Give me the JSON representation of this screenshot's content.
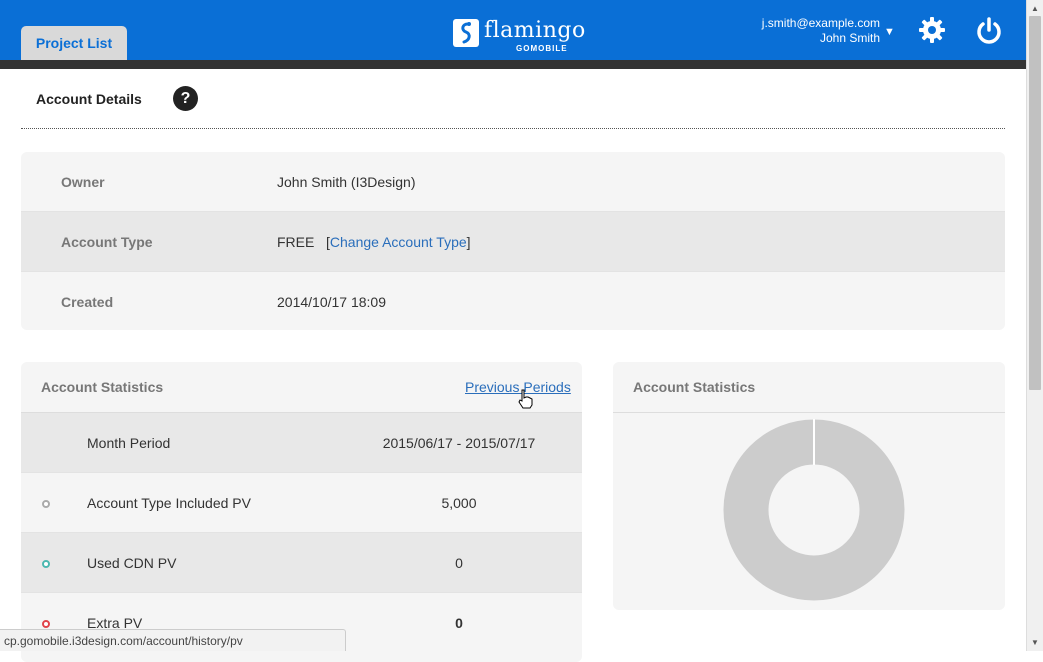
{
  "header": {
    "tab_label": "Project List",
    "logo_text": "flamingo",
    "logo_sub": "GOMOBILE",
    "user_email": "j.smith@example.com",
    "user_name": "John Smith",
    "icons": [
      "caret-down-icon",
      "gear-icon",
      "power-icon"
    ],
    "accent_color": "#0a6fd6"
  },
  "page": {
    "title": "Account Details",
    "help_icon": "?"
  },
  "details": [
    {
      "label": "Owner",
      "value": "John Smith (I3Design)"
    },
    {
      "label": "Account Type",
      "value": "FREE",
      "link_open": "[",
      "link_text": "Change Account Type",
      "link_close": "]"
    },
    {
      "label": "Created",
      "value": "2014/10/17 18:09"
    }
  ],
  "stats_left": {
    "title": "Account Statistics",
    "prev_link": "Previous Periods",
    "rows": [
      {
        "label": "Month Period",
        "value": "2015/06/17 - 2015/07/17",
        "dot_color": ""
      },
      {
        "label": "Account Type Included PV",
        "value": "5,000",
        "dot_color": "#aaaaaa"
      },
      {
        "label": "Used CDN PV",
        "value": "0",
        "dot_color": "#4bb8b0"
      },
      {
        "label": "Extra PV",
        "value": "0",
        "dot_color": "#e0444b"
      }
    ]
  },
  "stats_right": {
    "title": "Account Statistics",
    "donut_color": "#cccccc"
  },
  "status_bar": {
    "url": "cp.gomobile.i3design.com/account/history/pv"
  }
}
